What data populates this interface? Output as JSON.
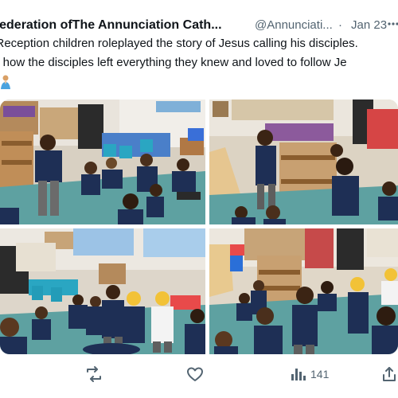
{
  "tweet": {
    "author": "e Federation ofThe Annunciation Cath...",
    "handle": "@Annunciati...",
    "separator": "·",
    "date": "Jan 23",
    "text_line1": "e Reception children roleplayed the story of Jesus calling his disciples.",
    "text_line2": "rnt how the disciples left everything they knew and loved to follow Je",
    "views": "141"
  },
  "media": {
    "photo_count": 4
  },
  "icons": {
    "more": "more-icon",
    "retweet": "retweet-icon",
    "like": "heart-icon",
    "views": "views-icon",
    "share": "share-icon",
    "emoji": "praying-person-emoji"
  },
  "colors": {
    "text": "#0f1419",
    "secondary": "#536471",
    "floor": "#5ea1a1",
    "uniform": "#1e2f55"
  }
}
